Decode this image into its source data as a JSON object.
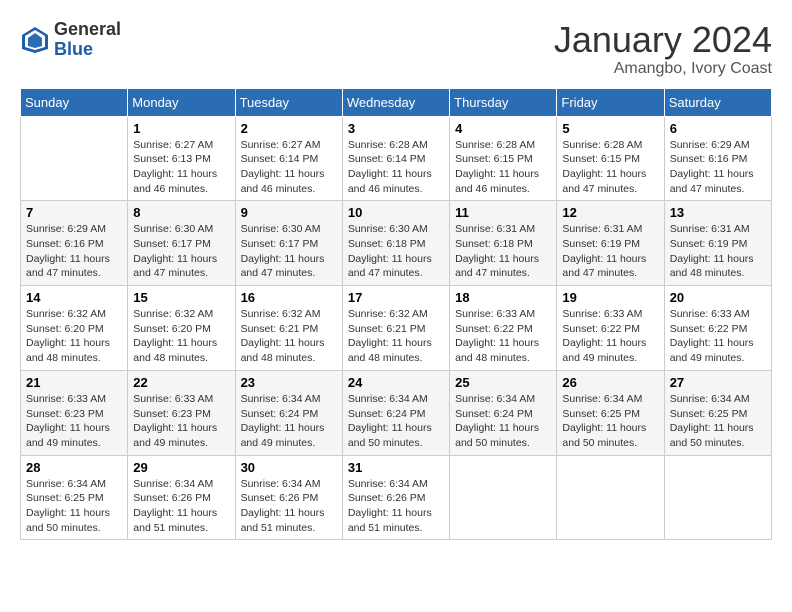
{
  "header": {
    "logo_general": "General",
    "logo_blue": "Blue",
    "title": "January 2024",
    "subtitle": "Amangbo, Ivory Coast"
  },
  "days_of_week": [
    "Sunday",
    "Monday",
    "Tuesday",
    "Wednesday",
    "Thursday",
    "Friday",
    "Saturday"
  ],
  "weeks": [
    [
      {
        "day": "",
        "info": ""
      },
      {
        "day": "1",
        "info": "Sunrise: 6:27 AM\nSunset: 6:13 PM\nDaylight: 11 hours and 46 minutes."
      },
      {
        "day": "2",
        "info": "Sunrise: 6:27 AM\nSunset: 6:14 PM\nDaylight: 11 hours and 46 minutes."
      },
      {
        "day": "3",
        "info": "Sunrise: 6:28 AM\nSunset: 6:14 PM\nDaylight: 11 hours and 46 minutes."
      },
      {
        "day": "4",
        "info": "Sunrise: 6:28 AM\nSunset: 6:15 PM\nDaylight: 11 hours and 46 minutes."
      },
      {
        "day": "5",
        "info": "Sunrise: 6:28 AM\nSunset: 6:15 PM\nDaylight: 11 hours and 47 minutes."
      },
      {
        "day": "6",
        "info": "Sunrise: 6:29 AM\nSunset: 6:16 PM\nDaylight: 11 hours and 47 minutes."
      }
    ],
    [
      {
        "day": "7",
        "info": "Sunrise: 6:29 AM\nSunset: 6:16 PM\nDaylight: 11 hours and 47 minutes."
      },
      {
        "day": "8",
        "info": "Sunrise: 6:30 AM\nSunset: 6:17 PM\nDaylight: 11 hours and 47 minutes."
      },
      {
        "day": "9",
        "info": "Sunrise: 6:30 AM\nSunset: 6:17 PM\nDaylight: 11 hours and 47 minutes."
      },
      {
        "day": "10",
        "info": "Sunrise: 6:30 AM\nSunset: 6:18 PM\nDaylight: 11 hours and 47 minutes."
      },
      {
        "day": "11",
        "info": "Sunrise: 6:31 AM\nSunset: 6:18 PM\nDaylight: 11 hours and 47 minutes."
      },
      {
        "day": "12",
        "info": "Sunrise: 6:31 AM\nSunset: 6:19 PM\nDaylight: 11 hours and 47 minutes."
      },
      {
        "day": "13",
        "info": "Sunrise: 6:31 AM\nSunset: 6:19 PM\nDaylight: 11 hours and 48 minutes."
      }
    ],
    [
      {
        "day": "14",
        "info": "Sunrise: 6:32 AM\nSunset: 6:20 PM\nDaylight: 11 hours and 48 minutes."
      },
      {
        "day": "15",
        "info": "Sunrise: 6:32 AM\nSunset: 6:20 PM\nDaylight: 11 hours and 48 minutes."
      },
      {
        "day": "16",
        "info": "Sunrise: 6:32 AM\nSunset: 6:21 PM\nDaylight: 11 hours and 48 minutes."
      },
      {
        "day": "17",
        "info": "Sunrise: 6:32 AM\nSunset: 6:21 PM\nDaylight: 11 hours and 48 minutes."
      },
      {
        "day": "18",
        "info": "Sunrise: 6:33 AM\nSunset: 6:22 PM\nDaylight: 11 hours and 48 minutes."
      },
      {
        "day": "19",
        "info": "Sunrise: 6:33 AM\nSunset: 6:22 PM\nDaylight: 11 hours and 49 minutes."
      },
      {
        "day": "20",
        "info": "Sunrise: 6:33 AM\nSunset: 6:22 PM\nDaylight: 11 hours and 49 minutes."
      }
    ],
    [
      {
        "day": "21",
        "info": "Sunrise: 6:33 AM\nSunset: 6:23 PM\nDaylight: 11 hours and 49 minutes."
      },
      {
        "day": "22",
        "info": "Sunrise: 6:33 AM\nSunset: 6:23 PM\nDaylight: 11 hours and 49 minutes."
      },
      {
        "day": "23",
        "info": "Sunrise: 6:34 AM\nSunset: 6:24 PM\nDaylight: 11 hours and 49 minutes."
      },
      {
        "day": "24",
        "info": "Sunrise: 6:34 AM\nSunset: 6:24 PM\nDaylight: 11 hours and 50 minutes."
      },
      {
        "day": "25",
        "info": "Sunrise: 6:34 AM\nSunset: 6:24 PM\nDaylight: 11 hours and 50 minutes."
      },
      {
        "day": "26",
        "info": "Sunrise: 6:34 AM\nSunset: 6:25 PM\nDaylight: 11 hours and 50 minutes."
      },
      {
        "day": "27",
        "info": "Sunrise: 6:34 AM\nSunset: 6:25 PM\nDaylight: 11 hours and 50 minutes."
      }
    ],
    [
      {
        "day": "28",
        "info": "Sunrise: 6:34 AM\nSunset: 6:25 PM\nDaylight: 11 hours and 50 minutes."
      },
      {
        "day": "29",
        "info": "Sunrise: 6:34 AM\nSunset: 6:26 PM\nDaylight: 11 hours and 51 minutes."
      },
      {
        "day": "30",
        "info": "Sunrise: 6:34 AM\nSunset: 6:26 PM\nDaylight: 11 hours and 51 minutes."
      },
      {
        "day": "31",
        "info": "Sunrise: 6:34 AM\nSunset: 6:26 PM\nDaylight: 11 hours and 51 minutes."
      },
      {
        "day": "",
        "info": ""
      },
      {
        "day": "",
        "info": ""
      },
      {
        "day": "",
        "info": ""
      }
    ]
  ]
}
